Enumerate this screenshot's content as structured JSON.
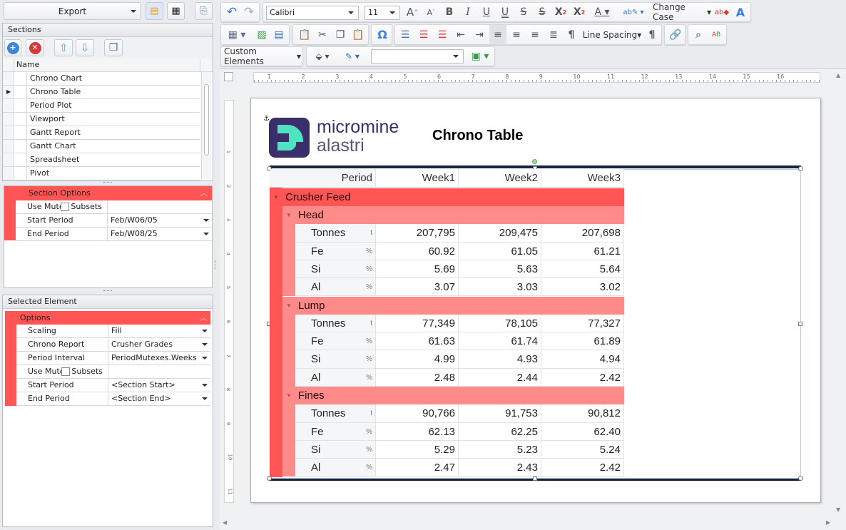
{
  "left": {
    "export_label": "Export",
    "sections": {
      "title": "Sections",
      "column": "Name",
      "items": [
        "Chrono Chart",
        "Chrono Table",
        "Period Plot",
        "Viewport",
        "Gantt Report",
        "Gantt Chart",
        "Spreadsheet",
        "Pivot"
      ],
      "selected_index": 1
    },
    "section_options": {
      "title": "Section Options",
      "rows": [
        {
          "label": "Use Mutex Subsets",
          "value": "",
          "checkbox": true
        },
        {
          "label": "Start Period",
          "value": "Feb/W06/05"
        },
        {
          "label": "End Period",
          "value": "Feb/W08/25"
        }
      ]
    },
    "selected_element": {
      "title": "Selected Element",
      "group": "Options",
      "rows": [
        {
          "label": "Scaling",
          "value": "Fill"
        },
        {
          "label": "Chrono Report",
          "value": "Crusher Grades"
        },
        {
          "label": "Period Interval",
          "value": "PeriodMutexes.Weeks"
        },
        {
          "label": "Use Mutex Subsets",
          "value": "",
          "checkbox": true
        },
        {
          "label": "Start Period",
          "value": "<Section Start>"
        },
        {
          "label": "End Period",
          "value": "<Section End>"
        }
      ]
    }
  },
  "toolbar": {
    "font": "Calibri",
    "size": "11",
    "change_case": "Change Case",
    "line_spacing": "Line Spacing",
    "custom_elements": "Custom Elements",
    "style_value": ""
  },
  "ruler": {
    "h": [
      "1",
      "2",
      "3",
      "4",
      "5",
      "6",
      "7",
      "8",
      "9",
      "10",
      "11",
      "12",
      "13",
      "14",
      "15",
      "16"
    ],
    "v": [
      "1",
      "2",
      "3",
      "4",
      "5",
      "6",
      "7",
      "8",
      "9",
      "10",
      "11"
    ]
  },
  "document": {
    "logo": {
      "line1": "micromine",
      "line2": "alastri"
    },
    "title": "Chrono Table",
    "table": {
      "header": "Period",
      "columns": [
        "Week1",
        "Week2",
        "Week3"
      ],
      "group": "Crusher Feed",
      "subgroups": [
        {
          "name": "Head",
          "rows": [
            {
              "label": "Tonnes",
              "unit": "t",
              "values": [
                "207,795",
                "209,475",
                "207,698"
              ]
            },
            {
              "label": "Fe",
              "unit": "%",
              "values": [
                "60.92",
                "61.05",
                "61.21"
              ]
            },
            {
              "label": "Si",
              "unit": "%",
              "values": [
                "5.69",
                "5.63",
                "5.64"
              ]
            },
            {
              "label": "Al",
              "unit": "%",
              "values": [
                "3.07",
                "3.03",
                "3.02"
              ]
            }
          ]
        },
        {
          "name": "Lump",
          "rows": [
            {
              "label": "Tonnes",
              "unit": "t",
              "values": [
                "77,349",
                "78,105",
                "77,327"
              ]
            },
            {
              "label": "Fe",
              "unit": "%",
              "values": [
                "61.63",
                "61.74",
                "61.89"
              ]
            },
            {
              "label": "Si",
              "unit": "%",
              "values": [
                "4.99",
                "4.93",
                "4.94"
              ]
            },
            {
              "label": "Al",
              "unit": "%",
              "values": [
                "2.48",
                "2.44",
                "2.42"
              ]
            }
          ]
        },
        {
          "name": "Fines",
          "rows": [
            {
              "label": "Tonnes",
              "unit": "t",
              "values": [
                "90,766",
                "91,753",
                "90,812"
              ]
            },
            {
              "label": "Fe",
              "unit": "%",
              "values": [
                "62.13",
                "62.25",
                "62.40"
              ]
            },
            {
              "label": "Si",
              "unit": "%",
              "values": [
                "5.29",
                "5.23",
                "5.24"
              ]
            },
            {
              "label": "Al",
              "unit": "%",
              "values": [
                "2.47",
                "2.43",
                "2.42"
              ]
            }
          ]
        }
      ]
    }
  },
  "colors": {
    "group": "#ff5555",
    "subgroup": "#ff8a8a",
    "accent": "#4a7fd4"
  }
}
